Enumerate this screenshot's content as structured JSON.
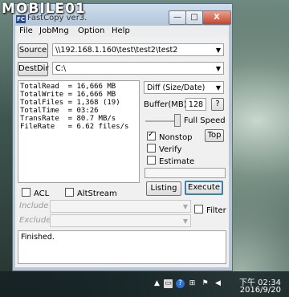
{
  "watermark": "MOBILE01",
  "window": {
    "title": "FastCopy ver3.",
    "icon_label": "FC",
    "buttons": {
      "minimize": "—",
      "maximize": "□",
      "close": "X"
    }
  },
  "menu": [
    "File",
    "JobMng",
    "Option",
    "Help"
  ],
  "source": {
    "button": "Source",
    "value": "\\\\192.168.1.160\\test\\test2\\test2"
  },
  "destdir": {
    "button": "DestDir",
    "value": "C:\\"
  },
  "stats": {
    "lines": [
      "TotalRead  = 16,666 MB",
      "TotalWrite = 16,666 MB",
      "TotalFiles = 1,368 (19)",
      "TotalTime  = 03:26",
      "TransRate  = 80.7 MB/s",
      "FileRate   = 6.62 files/s"
    ]
  },
  "mode": {
    "value": "Diff (Size/Date)"
  },
  "buffer": {
    "label": "Buffer(MB)",
    "value": "128",
    "help": "?"
  },
  "speed": {
    "label": "Full Speed"
  },
  "options": {
    "nonstop": {
      "label": "Nonstop",
      "checked": true
    },
    "top": "Top",
    "verify": {
      "label": "Verify",
      "checked": false
    },
    "estimate": {
      "label": "Estimate",
      "checked": false
    }
  },
  "acl": {
    "label": "ACL",
    "checked": false
  },
  "altstream": {
    "label": "AltStream",
    "checked": false
  },
  "listing": "Listing",
  "execute": "Execute",
  "include": {
    "label": "Include"
  },
  "exclude": {
    "label": "Exclude"
  },
  "filter": {
    "label": "Filter",
    "checked": false
  },
  "status_text": "Finished.",
  "taskbar": {
    "time_label": "下午 02:34",
    "date": "2016/9/20"
  }
}
